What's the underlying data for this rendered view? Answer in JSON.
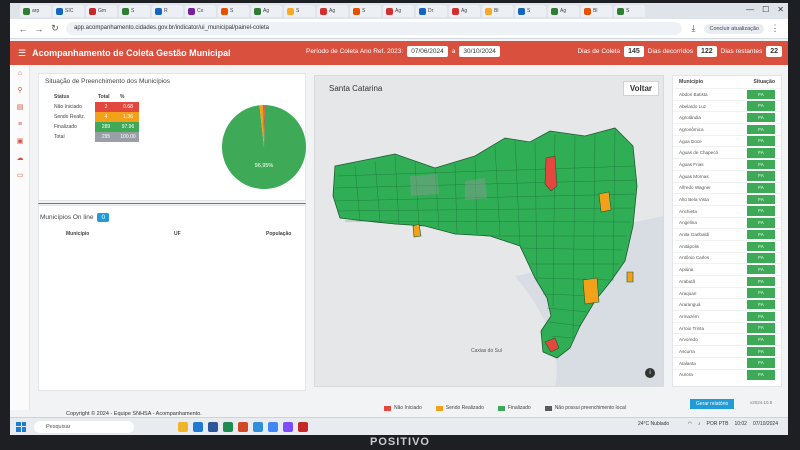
{
  "browser": {
    "tabs": [
      "arp",
      "SIC",
      "Gm",
      "S",
      "R",
      "Cx",
      "S",
      "Ag",
      "S",
      "Ag",
      "S",
      "Ag",
      "Dr",
      "Ag",
      "Bl",
      "S",
      "Ag",
      "Bl",
      "S"
    ],
    "url": "app.acompanhamento.cidades.gov.br/indicator/ui_municipal/painel-coleta",
    "profile": "Concluir atualização"
  },
  "header": {
    "title": "Acompanhamento de Coleta Gestão Municipal",
    "period_label": "Período de Coleta Ano Ref. 2023:",
    "date_start": "07/06/2024",
    "date_sep": "a",
    "date_end": "30/10/2024",
    "days_collect_label": "Dias de Coleta",
    "days_collect": "145",
    "days_elapsed_label": "Dias decorridos",
    "days_elapsed": "122",
    "days_left_label": "Dias restantes",
    "days_left": "22"
  },
  "status_panel": {
    "title": "Situação de Preenchimento dos Municípios",
    "columns": [
      "Status",
      "Total",
      "%"
    ],
    "rows": [
      {
        "label": "Não Iniciado",
        "total": "2",
        "pct": "0.68"
      },
      {
        "label": "Sendo Realiz.",
        "total": "4",
        "pct": "1.36"
      },
      {
        "label": "Finalizado",
        "total": "289",
        "pct": "97.96"
      },
      {
        "label": "Total",
        "total": "295",
        "pct": "100.00"
      }
    ],
    "pie_label": "96,95%",
    "pie": [
      {
        "name": "Não Iniciado",
        "value": 0.68,
        "color": "#e3473d"
      },
      {
        "name": "Sendo Realiz.",
        "value": 1.36,
        "color": "#f3a11a"
      },
      {
        "name": "Finalizado",
        "value": 97.96,
        "color": "#3eaa58"
      }
    ]
  },
  "online": {
    "title": "Municípios On line",
    "count": "0",
    "columns": [
      "Município",
      "UF",
      "População"
    ]
  },
  "map": {
    "title": "Santa Catarina",
    "back_label": "Voltar",
    "info_label": "i",
    "city_label": "Caxias do Sul",
    "legend": [
      {
        "label": "Não Iniciado",
        "color": "#e3473d"
      },
      {
        "label": "Sendo Realizado",
        "color": "#f3a11a"
      },
      {
        "label": "Finalizado",
        "color": "#3eaa58"
      },
      {
        "label": "Não possui preenchimento local",
        "color": "#555a60"
      }
    ]
  },
  "list": {
    "col_name": "Município",
    "col_status": "Situação",
    "items": [
      {
        "name": "Abdon Batista",
        "status": "FA"
      },
      {
        "name": "Abelardo Luz",
        "status": "FA"
      },
      {
        "name": "Agrolândia",
        "status": "FA"
      },
      {
        "name": "Agronômica",
        "status": "FA"
      },
      {
        "name": "Água Doce",
        "status": "FA"
      },
      {
        "name": "Águas de Chapecó",
        "status": "FA"
      },
      {
        "name": "Águas Frias",
        "status": "FA"
      },
      {
        "name": "Águas Mornas",
        "status": "FA"
      },
      {
        "name": "Alfredo Wagner",
        "status": "FA"
      },
      {
        "name": "Alto Bela Vista",
        "status": "FA"
      },
      {
        "name": "Anchieta",
        "status": "FA"
      },
      {
        "name": "Angelina",
        "status": "FA"
      },
      {
        "name": "Anita Garibaldi",
        "status": "FA"
      },
      {
        "name": "Anitápolis",
        "status": "FA"
      },
      {
        "name": "Antônio Carlos",
        "status": "FA"
      },
      {
        "name": "Apiúna",
        "status": "FA"
      },
      {
        "name": "Arabutã",
        "status": "FA"
      },
      {
        "name": "Araquari",
        "status": "FA"
      },
      {
        "name": "Araranguá",
        "status": "FA"
      },
      {
        "name": "Armazém",
        "status": "FA"
      },
      {
        "name": "Arroio Trinta",
        "status": "FA"
      },
      {
        "name": "Arvoredo",
        "status": "FA"
      },
      {
        "name": "Ascurra",
        "status": "FA"
      },
      {
        "name": "Atalanta",
        "status": "FA"
      },
      {
        "name": "Aurora",
        "status": "FA"
      }
    ],
    "history_label": "Gerar relatório",
    "version": "v2024.10.5"
  },
  "footer": {
    "text": "Copyright © 2024 - Equipe SNHSA - Acompanhamento."
  },
  "taskbar": {
    "search_placeholder": "Pesquisar",
    "weather": "24°C  Nublado",
    "lang": "POR PTB",
    "time": "10:02",
    "date": "07/10/2024"
  },
  "monitor_brand": "POSITIVO"
}
